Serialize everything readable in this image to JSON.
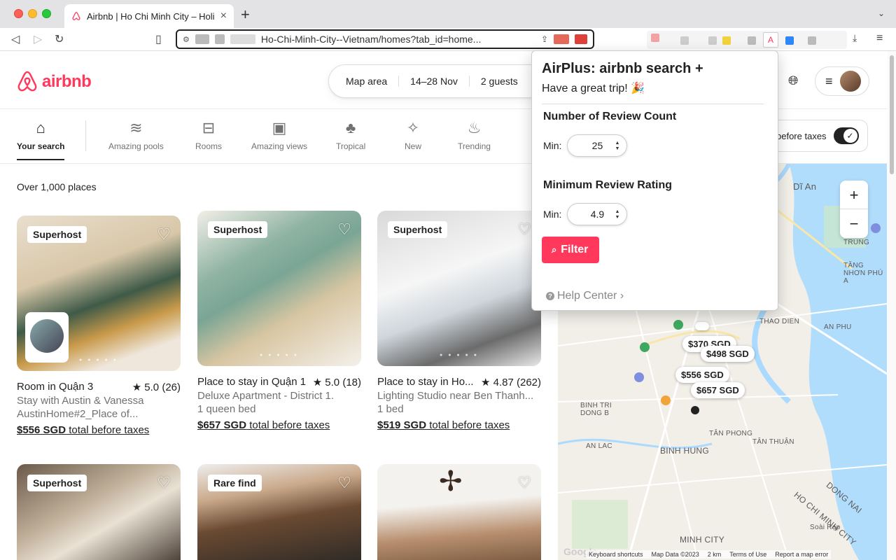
{
  "browser": {
    "tab_title": "Airbnb | Ho Chi Minh City – Holiday Rentals",
    "new_tab": "+",
    "url_text": "Ho-Chi-Minh-City--Vietnam/homes?tab_id=home..."
  },
  "header": {
    "logo_text": "airbnb",
    "search": [
      "Map area",
      "14–28 Nov",
      "2 guests"
    ]
  },
  "categories": [
    {
      "label": "Your search",
      "icon": "home-icon",
      "glyph": "⌂",
      "active": true
    },
    {
      "label": "Amazing pools",
      "icon": "pool-icon",
      "glyph": "≋"
    },
    {
      "label": "Rooms",
      "icon": "bed-icon",
      "glyph": "⊟"
    },
    {
      "label": "Amazing views",
      "icon": "view-icon",
      "glyph": "▣"
    },
    {
      "label": "Tropical",
      "icon": "palm-icon",
      "glyph": "♣"
    },
    {
      "label": "New",
      "icon": "key-icon",
      "glyph": "✧"
    },
    {
      "label": "Trending",
      "icon": "flame-icon",
      "glyph": "♨"
    }
  ],
  "tax_toggle_label": "before taxes",
  "results_count": "Over 1,000 places",
  "listings": [
    {
      "badge": "Superhost",
      "title": "Room in Quận 3",
      "rating": "★ 5.0 (26)",
      "line1": "Stay with Austin & Vanessa",
      "line2": "AustinHome#2_Place of...",
      "price": "$556 SGD",
      "price_suffix": " total before taxes"
    },
    {
      "badge": "Superhost",
      "title": "Place to stay in Quận 1",
      "rating": "★ 5.0 (18)",
      "line1": "Deluxe Apartment - District 1.",
      "line2": "1 queen bed",
      "price": "$657 SGD",
      "price_suffix": " total before taxes"
    },
    {
      "badge": "Superhost",
      "title": "Place to stay in Ho...",
      "rating": "★ 4.87 (262)",
      "line1": "Lighting Studio near Ben Thanh...",
      "line2": "1 bed",
      "price": "$519 SGD",
      "price_suffix": " total before taxes"
    },
    {
      "badge": "Superhost"
    },
    {
      "badge": "Rare find"
    },
    {
      "badge": ""
    }
  ],
  "map": {
    "labels": [
      "Dĩ An",
      "LINH TRUNG",
      "TĂNG NHƠN PHÚ A",
      "THAO DIEN",
      "AN PHU",
      "BINH TRI DONG B",
      "TÂN PHONG",
      "TÂN THUẬN",
      "AN LAC",
      "BINH HUNG",
      "HO CHI MINH CITY",
      "DONG NAI",
      "Soài Rạp",
      "MINH CITY"
    ],
    "pins": [
      "$370 SGD",
      "$498 SGD",
      "$556 SGD",
      "$657 SGD"
    ],
    "footer": [
      "Keyboard shortcuts",
      "Map Data ©2023",
      "2 km",
      "Terms of Use",
      "Report a map error"
    ],
    "google": "Google"
  },
  "popup": {
    "title": "AirPlus: airbnb search +",
    "subtitle": "Have a great trip! 🎉",
    "review_count_heading": "Number of Review Count",
    "review_count_label": "Min:",
    "review_count_value": "25",
    "rating_heading": "Minimum Review Rating",
    "rating_label": "Min:",
    "rating_value": "4.9",
    "filter_label": "Filter",
    "help_label": "Help Center ›"
  },
  "colors": {
    "brand": "#ff385c",
    "map_bg": "#f2efe9",
    "river": "#aadaff"
  }
}
